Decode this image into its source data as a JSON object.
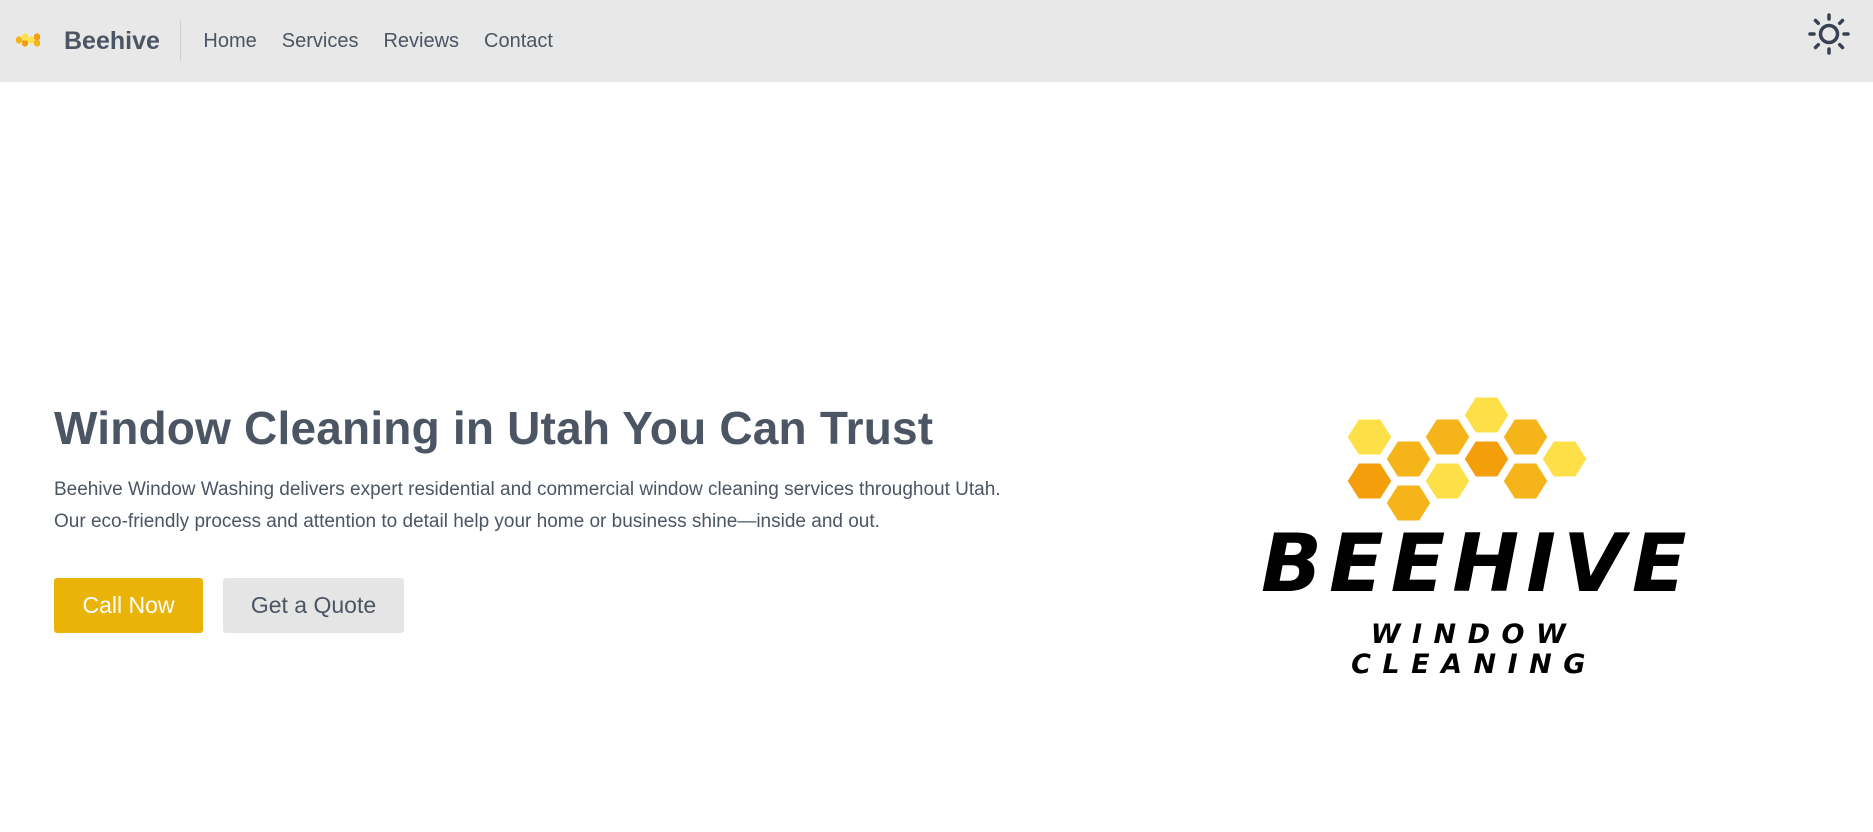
{
  "header": {
    "brand_name": "Beehive",
    "nav": [
      {
        "label": "Home"
      },
      {
        "label": "Services"
      },
      {
        "label": "Reviews"
      },
      {
        "label": "Contact"
      }
    ],
    "theme_toggle_icon": "sun-icon"
  },
  "hero": {
    "title": "Window Cleaning in Utah You Can Trust",
    "description_line1": "Beehive Window Washing delivers expert residential and commercial window cleaning services throughout Utah.",
    "description_line2": "Our eco-friendly process and attention to detail help your home or business shine—inside and out.",
    "primary_button": "Call Now",
    "secondary_button": "Get a Quote"
  },
  "logo": {
    "word1": "BEEHIVE",
    "word2": "WINDOW CLEANING",
    "icon": "honeycomb-logo"
  },
  "colors": {
    "accent": "#eab308",
    "nav_background": "#e8e8e8",
    "text": "#4b5563",
    "honey_light": "#fde047",
    "honey_mid": "#f5b41a",
    "honey_dark": "#f59e0b"
  }
}
